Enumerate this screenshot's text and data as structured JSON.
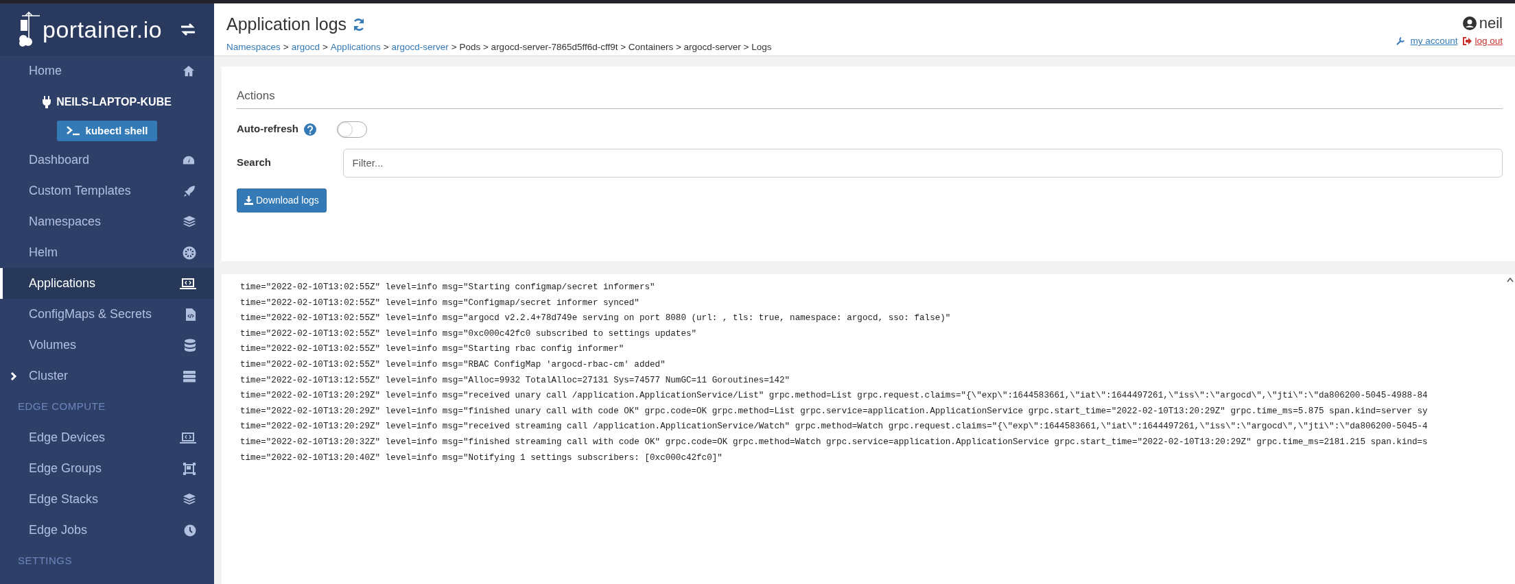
{
  "sidebar": {
    "logo_text": "portainer.io",
    "items": [
      {
        "kind": "link",
        "label": "Home",
        "selected": false
      },
      {
        "kind": "endpoint",
        "label": "NEILS-LAPTOP-KUBE"
      },
      {
        "kind": "button",
        "label": "kubectl shell"
      },
      {
        "kind": "link",
        "label": "Dashboard",
        "selected": false
      },
      {
        "kind": "link",
        "label": "Custom Templates",
        "selected": false
      },
      {
        "kind": "link",
        "label": "Namespaces",
        "selected": false
      },
      {
        "kind": "link",
        "label": "Helm",
        "selected": false
      },
      {
        "kind": "link",
        "label": "Applications",
        "selected": true
      },
      {
        "kind": "link",
        "label": "ConfigMaps & Secrets",
        "selected": false
      },
      {
        "kind": "link",
        "label": "Volumes",
        "selected": false
      },
      {
        "kind": "group",
        "label": "Cluster",
        "selected": false,
        "expanded": false
      },
      {
        "kind": "heading",
        "label": "EDGE COMPUTE"
      },
      {
        "kind": "link",
        "label": "Edge Devices",
        "selected": false
      },
      {
        "kind": "link",
        "label": "Edge Groups",
        "selected": false
      },
      {
        "kind": "link",
        "label": "Edge Stacks",
        "selected": false
      },
      {
        "kind": "link",
        "label": "Edge Jobs",
        "selected": false
      },
      {
        "kind": "heading",
        "label": "SETTINGS"
      }
    ]
  },
  "header": {
    "title": "Application logs",
    "breadcrumb": [
      {
        "text": "Namespaces",
        "link": true
      },
      {
        "text": ">",
        "link": false
      },
      {
        "text": "argocd",
        "link": true
      },
      {
        "text": ">",
        "link": false
      },
      {
        "text": "Applications",
        "link": true
      },
      {
        "text": ">",
        "link": false
      },
      {
        "text": "argocd-server",
        "link": true
      },
      {
        "text": "> Pods > argocd-server-7865d5ff6d-cff9t > Containers > argocd-server > Logs",
        "link": false
      }
    ],
    "user": "neil",
    "my_account": "my account",
    "log_out": "log out"
  },
  "actions": {
    "title": "Actions",
    "auto_refresh": {
      "label": "Auto-refresh",
      "on": false
    },
    "search": {
      "label": "Search",
      "placeholder": "Filter..."
    },
    "download_button": "Download logs"
  },
  "logs": [
    "time=\"2022-02-10T13:02:55Z\" level=info msg=\"Starting configmap/secret informers\"",
    "time=\"2022-02-10T13:02:55Z\" level=info msg=\"Configmap/secret informer synced\"",
    "time=\"2022-02-10T13:02:55Z\" level=info msg=\"argocd v2.2.4+78d749e serving on port 8080 (url: , tls: true, namespace: argocd, sso: false)\"",
    "time=\"2022-02-10T13:02:55Z\" level=info msg=\"0xc000c42fc0 subscribed to settings updates\"",
    "time=\"2022-02-10T13:02:55Z\" level=info msg=\"Starting rbac config informer\"",
    "time=\"2022-02-10T13:02:55Z\" level=info msg=\"RBAC ConfigMap 'argocd-rbac-cm' added\"",
    "time=\"2022-02-10T13:12:55Z\" level=info msg=\"Alloc=9932 TotalAlloc=27131 Sys=74577 NumGC=11 Goroutines=142\"",
    "time=\"2022-02-10T13:20:29Z\" level=info msg=\"received unary call /application.ApplicationService/List\" grpc.method=List grpc.request.claims=\"{\\\"exp\\\":1644583661,\\\"iat\\\":1644497261,\\\"iss\\\":\\\"argocd\\\",\\\"jti\\\":\\\"da806200-5045-4988-84",
    "time=\"2022-02-10T13:20:29Z\" level=info msg=\"finished unary call with code OK\" grpc.code=OK grpc.method=List grpc.service=application.ApplicationService grpc.start_time=\"2022-02-10T13:20:29Z\" grpc.time_ms=5.875 span.kind=server sy",
    "time=\"2022-02-10T13:20:29Z\" level=info msg=\"received streaming call /application.ApplicationService/Watch\" grpc.method=Watch grpc.request.claims=\"{\\\"exp\\\":1644583661,\\\"iat\\\":1644497261,\\\"iss\\\":\\\"argocd\\\",\\\"jti\\\":\\\"da806200-5045-4",
    "time=\"2022-02-10T13:20:32Z\" level=info msg=\"finished streaming call with code OK\" grpc.code=OK grpc.method=Watch grpc.service=application.ApplicationService grpc.start_time=\"2022-02-10T13:20:29Z\" grpc.time_ms=2181.215 span.kind=s",
    "time=\"2022-02-10T13:20:40Z\" level=info msg=\"Notifying 1 settings subscribers: [0xc000c42fc0]\""
  ]
}
